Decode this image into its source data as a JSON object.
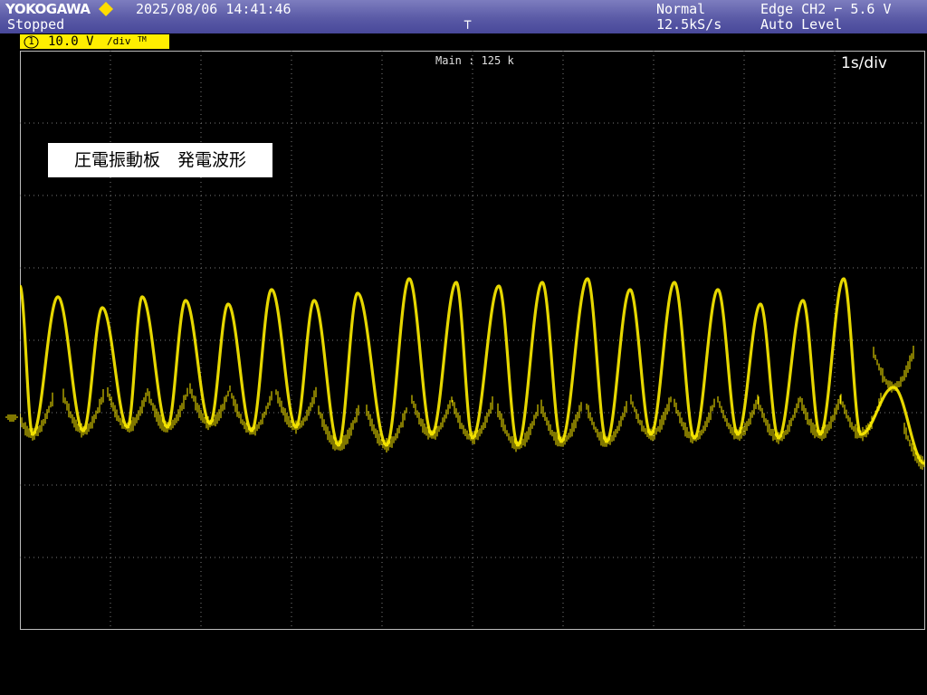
{
  "header": {
    "brand": "YOKOGAWA",
    "status": "Stopped",
    "datetime": "2025/08/06 14:41:46",
    "trigger_position_mark": "⊤",
    "mode": "Normal",
    "sample_rate": "12.5kS/s",
    "trigger_source": "Edge CH2 ⌐ 5.6 V",
    "trigger_level_mode": "Auto Level",
    "brand_color": "#ffdd00"
  },
  "channel": {
    "number": "1",
    "scale": "10.0 V",
    "unit": "/div",
    "suffix": "TM",
    "color": "#ffee00"
  },
  "display": {
    "zoom_info": "Main : 125 k",
    "timebase": "1s/div",
    "annotation": "圧電振動板　発電波形",
    "ground_marker_icon": "ground-icon"
  },
  "chart_data": {
    "type": "line",
    "title": "圧電振動板　発電波形",
    "xlabel": "",
    "ylabel": "",
    "x_unit": "s",
    "y_unit": "V",
    "xlim": [
      0,
      10
    ],
    "ylim": [
      -40,
      40
    ],
    "x_divisions": 10,
    "y_divisions": 8,
    "grid": true,
    "series": [
      {
        "color": "#ffee00",
        "x": [
          0.0,
          0.14,
          0.42,
          0.7,
          0.91,
          1.19,
          1.35,
          1.63,
          1.83,
          2.1,
          2.3,
          2.56,
          2.78,
          3.05,
          3.25,
          3.52,
          3.73,
          4.05,
          4.3,
          4.55,
          4.82,
          5.0,
          5.29,
          5.5,
          5.77,
          5.98,
          6.27,
          6.48,
          6.74,
          6.97,
          7.23,
          7.45,
          7.71,
          7.93,
          8.18,
          8.38,
          8.65,
          8.84,
          9.1,
          9.29,
          9.65,
          9.99
        ],
        "y": [
          7.5,
          -13.0,
          6.0,
          -12.5,
          4.5,
          -12.0,
          6.0,
          -12.0,
          5.5,
          -11.5,
          5.0,
          -12.5,
          7.0,
          -12.0,
          5.5,
          -14.5,
          6.5,
          -14.5,
          8.5,
          -13.0,
          8.0,
          -13.5,
          7.5,
          -14.5,
          8.0,
          -14.0,
          8.5,
          -14.0,
          7.0,
          -13.0,
          8.0,
          -13.5,
          7.0,
          -13.0,
          5.0,
          -13.5,
          5.5,
          -13.0,
          8.5,
          -13.0,
          -6.5,
          -17.0
        ]
      }
    ]
  }
}
